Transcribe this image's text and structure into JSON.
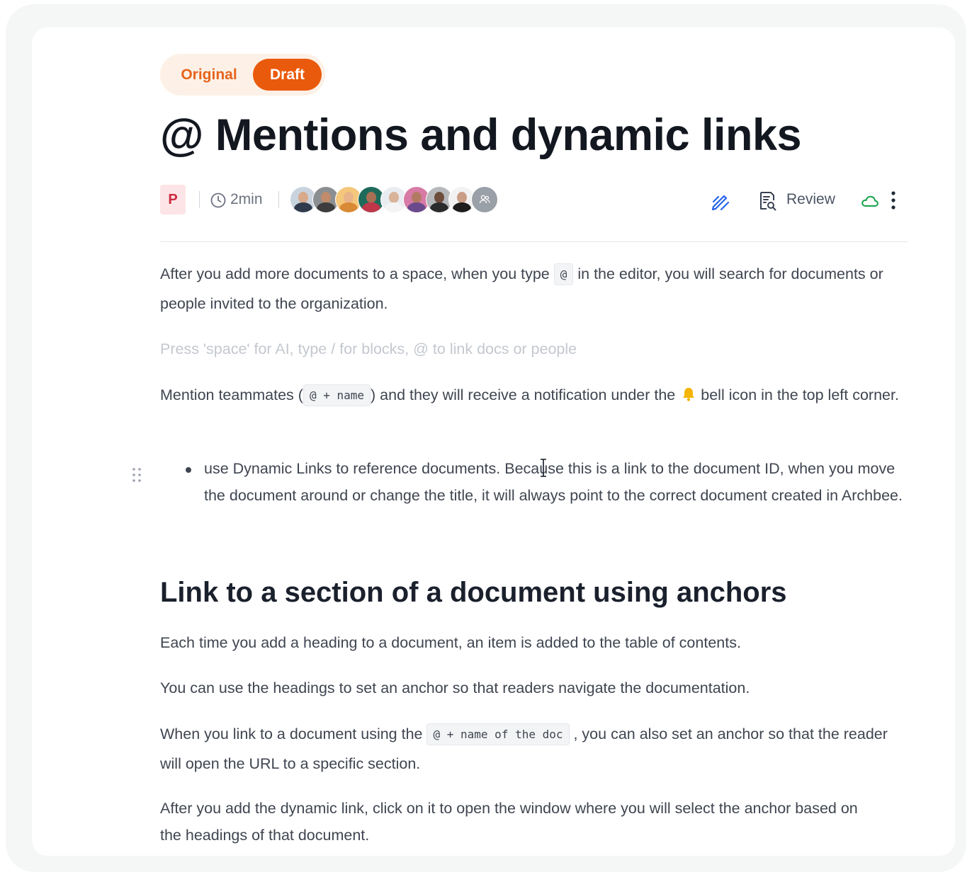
{
  "version_toggle": {
    "original": "Original",
    "draft": "Draft"
  },
  "title": "@ Mentions and dynamic links",
  "meta": {
    "author_initial": "P",
    "read_time": "2min",
    "review_label": "Review",
    "icons": [
      "clock-icon",
      "edit-pen-icon",
      "review-doc-icon",
      "cloud-sync-icon",
      "more-vertical-icon"
    ]
  },
  "paragraphs": {
    "p1_before": "After you add more documents to a space, when you type ",
    "p1_code": "@",
    "p1_after": " in the editor, you will search for documents or people invited to the organization.",
    "placeholder": "Press 'space' for AI, type / for blocks, @ to link docs or people",
    "p2_before": "Mention teammates (",
    "p2_code": "@ + name",
    "p2_middle": ") and they will receive a notification under the",
    "p2_after": "bell icon in the top left corner.",
    "bullet": "use Dynamic Links to reference documents. Because this is a link to the document ID, when you move the document around or change the title, it will always point to the correct document created in Archbee.",
    "heading": "Link to a section of a document using anchors",
    "p3": "Each time you add a heading to a document, an item is added to the table of contents.",
    "p4": "You can use the headings to set an anchor so that readers navigate the documentation.",
    "p5_before": "When you link to a document using the ",
    "p5_code": "@ + name of the doc",
    "p5_after": " , you can also set an anchor so that the reader will open the URL to a specific section.",
    "p6": "After you add the dynamic link, click on it to open the window where you will select the anchor based on the headings of that document."
  },
  "colors": {
    "accent": "#ea5a0c",
    "toggle_bg": "#fdf1e7",
    "review_icon": "#2563eb",
    "cloud_icon": "#16a34a"
  }
}
